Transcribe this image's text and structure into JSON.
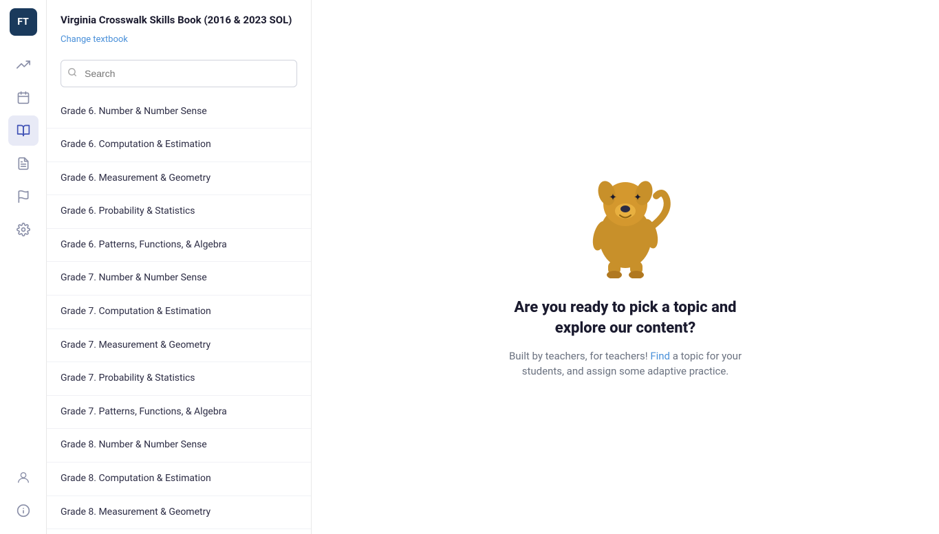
{
  "app": {
    "logo_label": "FT"
  },
  "sidebar": {
    "title": "Virginia Crosswalk Skills Book (2016 & 2023 SOL)",
    "change_textbook_label": "Change textbook",
    "search_placeholder": "Search",
    "items": [
      {
        "id": "g6-number",
        "label": "Grade 6. Number & Number Sense"
      },
      {
        "id": "g6-computation",
        "label": "Grade 6. Computation & Estimation"
      },
      {
        "id": "g6-measurement",
        "label": "Grade 6. Measurement & Geometry"
      },
      {
        "id": "g6-probability",
        "label": "Grade 6. Probability & Statistics"
      },
      {
        "id": "g6-patterns",
        "label": "Grade 6. Patterns, Functions, & Algebra"
      },
      {
        "id": "g7-number",
        "label": "Grade 7. Number & Number Sense"
      },
      {
        "id": "g7-computation",
        "label": "Grade 7. Computation & Estimation"
      },
      {
        "id": "g7-measurement",
        "label": "Grade 7. Measurement & Geometry"
      },
      {
        "id": "g7-probability",
        "label": "Grade 7. Probability & Statistics"
      },
      {
        "id": "g7-patterns",
        "label": "Grade 7. Patterns, Functions, & Algebra"
      },
      {
        "id": "g8-number",
        "label": "Grade 8. Number & Number Sense"
      },
      {
        "id": "g8-computation",
        "label": "Grade 8. Computation & Estimation"
      },
      {
        "id": "g8-measurement",
        "label": "Grade 8. Measurement & Geometry"
      }
    ]
  },
  "nav_icons": [
    {
      "id": "analytics",
      "icon": "📈",
      "label": "analytics-icon"
    },
    {
      "id": "calendar",
      "icon": "📅",
      "label": "calendar-icon"
    },
    {
      "id": "books",
      "icon": "📚",
      "label": "books-icon",
      "active": true
    },
    {
      "id": "document",
      "icon": "📄",
      "label": "document-icon"
    },
    {
      "id": "flag",
      "icon": "🚩",
      "label": "flag-icon"
    },
    {
      "id": "settings",
      "icon": "⚙",
      "label": "settings-icon"
    }
  ],
  "empty_state": {
    "title": "Are you ready to pick a topic and explore our content?",
    "subtitle_before": "Built by teachers, for teachers! Find a topic for your students, and assign some adaptive practice."
  }
}
